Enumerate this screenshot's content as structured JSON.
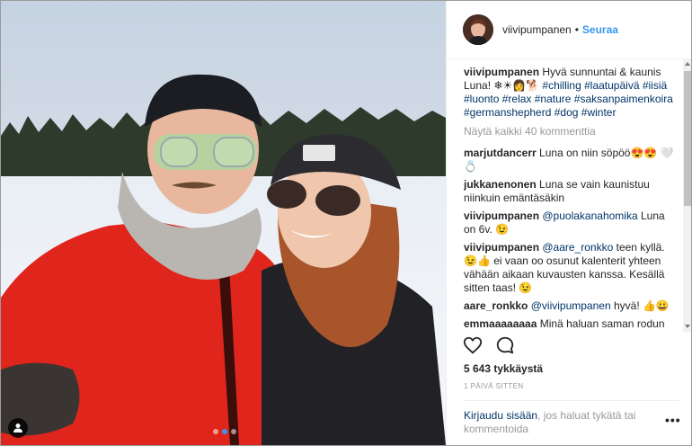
{
  "post": {
    "username": "viivipumpanen",
    "follow_label": "Seuraa",
    "separator": "•"
  },
  "caption": {
    "username": "viivipumpanen",
    "text": "Hyvä sunnuntai & kaunis Luna! ❄☀👩🐕",
    "hashtags": [
      "#chilling",
      "#laatupäivä",
      "#iisiä",
      "#luonto",
      "#relax",
      "#nature",
      "#saksanpaimenkoira",
      "#germanshepherd",
      "#dog",
      "#winter"
    ]
  },
  "view_all_label": "Näytä kaikki 40 kommenttia",
  "comments": [
    {
      "username": "marjutdancerr",
      "mention": "",
      "text": "Luna on niin söpöö😍😍 🤍💍"
    },
    {
      "username": "jukkanenonen",
      "mention": "",
      "text": "Luna se vain kaunistuu niinkuin emäntäsäkin"
    },
    {
      "username": "viivipumpanen",
      "mention": "@puolakanahomika",
      "text": "Luna on 6v. 😉"
    },
    {
      "username": "viivipumpanen",
      "mention": "@aare_ronkko",
      "text": "teen kyllä. 😉👍 ei vaan oo osunut kalenterit yhteen vähään aikaan kuvausten kanssa. Kesällä sitten taas! 😉"
    },
    {
      "username": "aare_ronkko",
      "mention": "@viivipumpanen",
      "text": "hyvä! 👍😀"
    },
    {
      "username": "emmaaaaaaaa",
      "mention": "",
      "text": "Minä haluan saman rodun"
    }
  ],
  "likes_label": "5 643 tykkäystä",
  "time_label": "1 PÄIVÄ SITTEN",
  "login": {
    "link_label": "Kirjaudu sisään",
    "rest_text": ", jos haluat tykätä tai kommentoida"
  },
  "more_label": "•••",
  "icons": {
    "like": "heart-icon",
    "comment": "comment-bubble-icon",
    "user_tag": "user-icon",
    "more": "more-options-icon"
  },
  "colors": {
    "link_blue": "#3897f0",
    "hashtag": "#003569",
    "muted": "#999999"
  }
}
